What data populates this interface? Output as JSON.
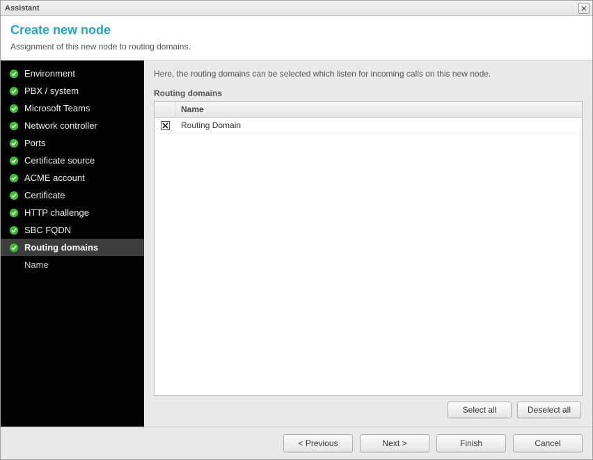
{
  "window": {
    "title": "Assistant"
  },
  "header": {
    "title": "Create new node",
    "subtitle": "Assignment of this new node to routing domains."
  },
  "sidebar": {
    "items": [
      {
        "label": "Environment",
        "done": true,
        "active": false
      },
      {
        "label": "PBX / system",
        "done": true,
        "active": false
      },
      {
        "label": "Microsoft Teams",
        "done": true,
        "active": false
      },
      {
        "label": "Network controller",
        "done": true,
        "active": false
      },
      {
        "label": "Ports",
        "done": true,
        "active": false
      },
      {
        "label": "Certificate source",
        "done": true,
        "active": false
      },
      {
        "label": "ACME account",
        "done": true,
        "active": false
      },
      {
        "label": "Certificate",
        "done": true,
        "active": false
      },
      {
        "label": "HTTP challenge",
        "done": true,
        "active": false
      },
      {
        "label": "SBC FQDN",
        "done": true,
        "active": false
      },
      {
        "label": "Routing domains",
        "done": true,
        "active": true
      }
    ],
    "sub_item": "Name"
  },
  "content": {
    "intro": "Here, the routing domains can be selected which listen for incoming calls on this new node.",
    "section_label": "Routing domains",
    "columns": {
      "name": "Name"
    },
    "rows": [
      {
        "checked": true,
        "name": "Routing Domain"
      }
    ],
    "buttons": {
      "select_all": "Select all",
      "deselect_all": "Deselect all"
    }
  },
  "footer": {
    "previous": "< Previous",
    "next": "Next >",
    "finish": "Finish",
    "cancel": "Cancel"
  }
}
